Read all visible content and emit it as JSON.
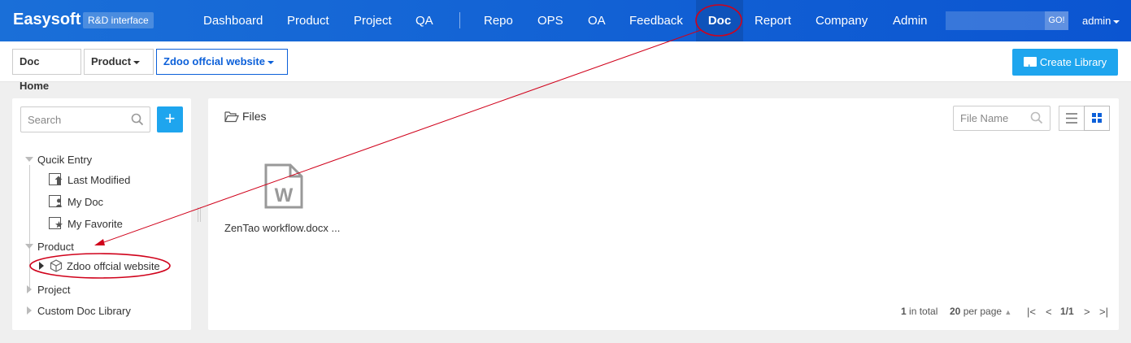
{
  "brand": {
    "name": "Easysoft",
    "tag": "R&D interface"
  },
  "nav": {
    "items": [
      "Dashboard",
      "Product",
      "Project",
      "QA",
      "Repo",
      "OPS",
      "OA",
      "Feedback",
      "Doc",
      "Report",
      "Company",
      "Admin"
    ],
    "active": "Doc",
    "search_placeholder": "",
    "go_label": "GO!",
    "user": "admin"
  },
  "breadcrumb": {
    "home": "Doc Home",
    "product": "Product",
    "current": "Zdoo offcial website"
  },
  "actions": {
    "create_library": "Create Library"
  },
  "sidebar": {
    "search_placeholder": "Search",
    "add_label": "+",
    "tree": {
      "quick_entry": "Qucik Entry",
      "quick_items": [
        "Last Modified",
        "My Doc",
        "My Favorite"
      ],
      "product": "Product",
      "product_items": [
        "Zdoo offcial website"
      ],
      "project": "Project",
      "custom": "Custom Doc Library"
    }
  },
  "main": {
    "title": "Files",
    "filter_placeholder": "File Name",
    "files": [
      {
        "name": "ZenTao workflow.docx ...",
        "type": "W"
      }
    ],
    "pager": {
      "total": "1",
      "total_label": "in total",
      "per_page": "20",
      "per_page_label": "per page",
      "page": "1/1"
    }
  },
  "colors": {
    "nav": "#0b55d1",
    "accent": "#1ea5ee",
    "annotation": "#d0021b"
  }
}
